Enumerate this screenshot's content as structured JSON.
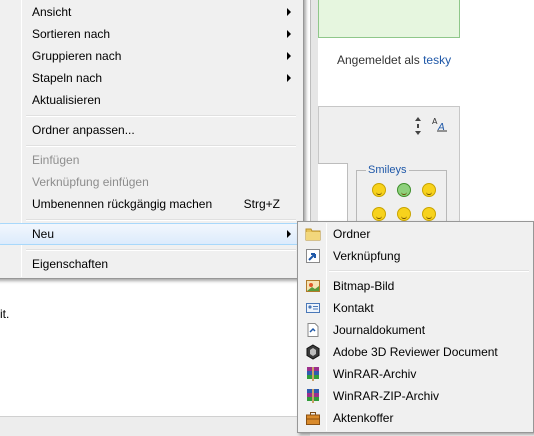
{
  "background": {
    "login_prefix": "Angemeldet als",
    "login_user": "tesky",
    "smileys_legend": "Smileys",
    "text_fragment": "it."
  },
  "context_menu": {
    "items": [
      {
        "label": "Ansicht",
        "submenu": true
      },
      {
        "label": "Sortieren nach",
        "submenu": true
      },
      {
        "label": "Gruppieren nach",
        "submenu": true
      },
      {
        "label": "Stapeln nach",
        "submenu": true
      },
      {
        "label": "Aktualisieren"
      },
      {
        "label": "Ordner anpassen..."
      },
      {
        "label": "Einfügen",
        "disabled": true
      },
      {
        "label": "Verknüpfung einfügen",
        "disabled": true
      },
      {
        "label": "Umbenennen rückgängig machen",
        "shortcut": "Strg+Z"
      },
      {
        "label": "Neu",
        "submenu": true,
        "highlighted": true
      },
      {
        "label": "Eigenschaften"
      }
    ]
  },
  "new_submenu": {
    "items": [
      {
        "label": "Ordner",
        "icon": "folder-icon"
      },
      {
        "label": "Verknüpfung",
        "icon": "shortcut-icon"
      },
      {
        "label": "Bitmap-Bild",
        "icon": "bitmap-icon"
      },
      {
        "label": "Kontakt",
        "icon": "contact-icon"
      },
      {
        "label": "Journaldokument",
        "icon": "journal-icon"
      },
      {
        "label": "Adobe 3D Reviewer Document",
        "icon": "adobe-3d-icon"
      },
      {
        "label": "WinRAR-Archiv",
        "icon": "winrar-icon"
      },
      {
        "label": "WinRAR-ZIP-Archiv",
        "icon": "winrar-zip-icon"
      },
      {
        "label": "Aktenkoffer",
        "icon": "briefcase-icon"
      }
    ]
  },
  "colors": {
    "menu_background": "#f0f0f0",
    "menu_border": "#979797",
    "highlight_border": "#a8d8fb",
    "disabled_text": "#8d8d8d",
    "link_blue": "#1f58a8"
  }
}
